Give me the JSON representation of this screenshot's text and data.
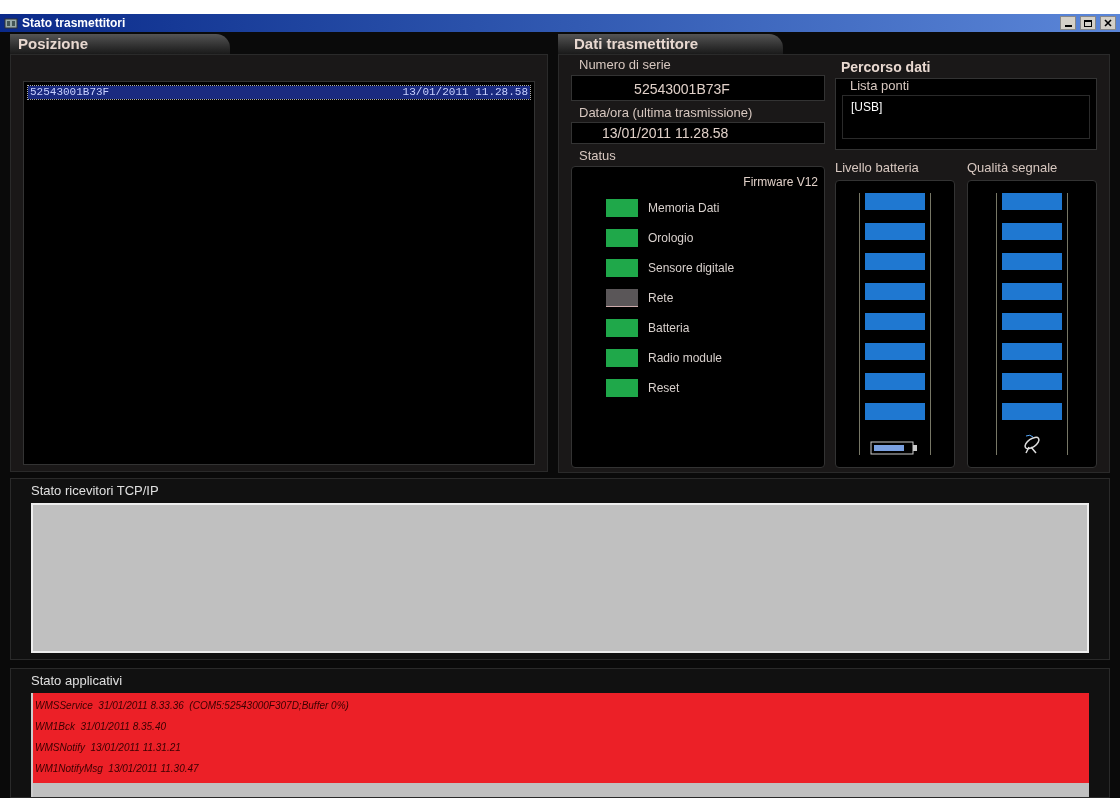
{
  "window": {
    "title": "Stato trasmettitori"
  },
  "posizione": {
    "tab": "Posizione",
    "rows": [
      {
        "serial": "52543001B73F",
        "datetime": "13/01/2011 11.28.58",
        "selected": true
      }
    ]
  },
  "dati": {
    "tab": "Dati trasmettitore",
    "serial_label": "Numero di serie",
    "serial": "52543001B73F",
    "datetime_label": "Data/ora (ultima trasmissione)",
    "datetime": "13/01/2011 11.28.58",
    "status_label": "Status",
    "firmware": "Firmware V12",
    "status": [
      {
        "label": "Memoria Dati",
        "on": true
      },
      {
        "label": "Orologio",
        "on": true
      },
      {
        "label": "Sensore digitale",
        "on": true
      },
      {
        "label": "Rete",
        "on": false
      },
      {
        "label": "Batteria",
        "on": true
      },
      {
        "label": "Radio module",
        "on": true
      },
      {
        "label": "Reset",
        "on": true
      }
    ],
    "percorso_title": "Percorso dati",
    "ponti_label": "Lista ponti",
    "ponti": [
      "[USB]"
    ],
    "battery": {
      "label": "Livello batteria",
      "level": 1
    },
    "signal": {
      "label": "Qualità segnale",
      "level": 1
    }
  },
  "tcp": {
    "label": "Stato ricevitori TCP/IP"
  },
  "applicativi": {
    "label": "Stato applicativi",
    "lines": [
      "WMSService  31/01/2011 8.33.36  (COM5:52543000F307D;Buffer 0%)",
      "WM1Bck  31/01/2011 8.35.40",
      "WMSNotify  13/01/2011 11.31.21",
      "WM1NotifyMsg  13/01/2011 11.30.47"
    ]
  }
}
